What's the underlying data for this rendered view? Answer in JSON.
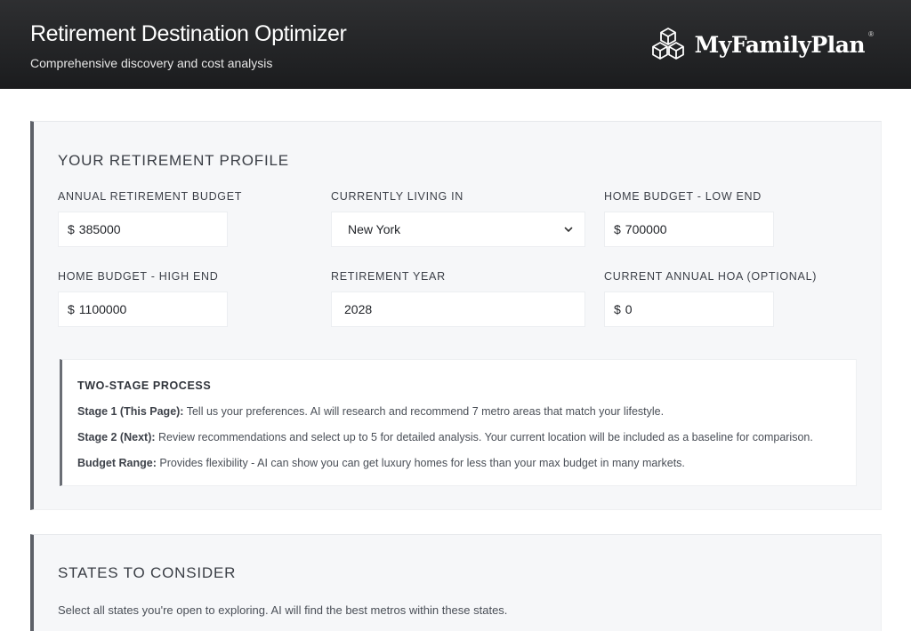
{
  "header": {
    "title": "Retirement Destination Optimizer",
    "subtitle": "Comprehensive discovery and cost analysis",
    "brand": "MyFamilyPlan",
    "brand_mark": "®",
    "logo_icon": "hexagon-cube-logo-icon"
  },
  "profile": {
    "heading": "YOUR RETIREMENT PROFILE",
    "annual_budget": {
      "label": "ANNUAL RETIREMENT BUDGET",
      "prefix": "$",
      "value": "385000"
    },
    "current_location": {
      "label": "CURRENTLY LIVING IN",
      "value": "New York",
      "icon": "chevron-down-icon"
    },
    "home_low": {
      "label": "HOME BUDGET - LOW END",
      "prefix": "$",
      "value": "700000"
    },
    "home_high": {
      "label": "HOME BUDGET - HIGH END",
      "prefix": "$",
      "value": "1100000"
    },
    "retirement_year": {
      "label": "RETIREMENT YEAR",
      "value": "2028"
    },
    "hoa": {
      "label": "CURRENT ANNUAL HOA (OPTIONAL)",
      "prefix": "$",
      "value": "0"
    }
  },
  "process": {
    "title": "TWO-STAGE PROCESS",
    "stage1_label": "Stage 1 (This Page):",
    "stage1_text": " Tell us your preferences. AI will research and recommend 7 metro areas that match your lifestyle.",
    "stage2_label": "Stage 2 (Next):",
    "stage2_text": " Review recommendations and select up to 5 for detailed analysis. Your current location will be included as a baseline for comparison.",
    "budget_label": "Budget Range:",
    "budget_text": " Provides flexibility - AI can show you can get luxury homes for less than your max budget in many markets."
  },
  "states": {
    "heading": "STATES TO CONSIDER",
    "description": "Select all states you're open to exploring. AI will find the best metros within these states."
  }
}
